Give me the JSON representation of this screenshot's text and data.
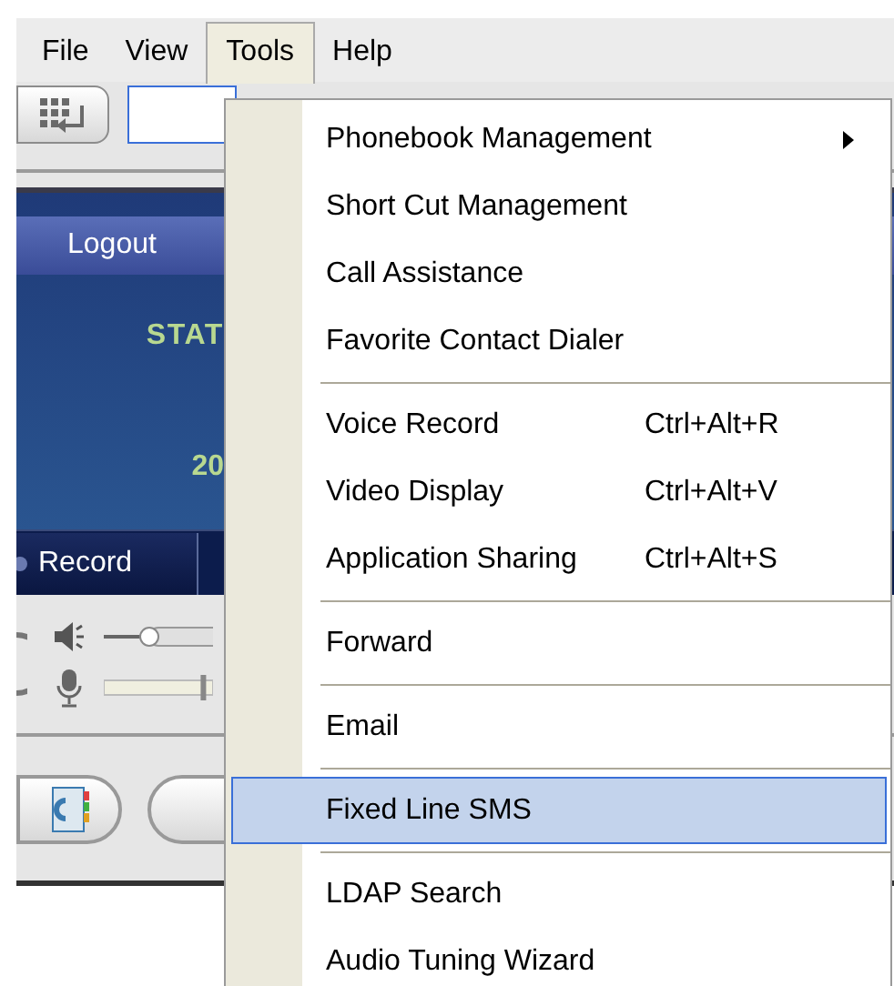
{
  "menu_bar": [
    {
      "label": "File",
      "selected": false
    },
    {
      "label": "View",
      "selected": false
    },
    {
      "label": "Tools",
      "selected": true
    },
    {
      "label": "Help",
      "selected": false
    }
  ],
  "sliders": {
    "speaker": {
      "level": 0.4
    },
    "microphone": {
      "level": 0.95
    }
  },
  "panel": {
    "logout": "Logout",
    "status": "STAT",
    "date": "20",
    "tab": "Record"
  },
  "tools_menu": [
    {
      "kind": "item",
      "label": "Phonebook Management",
      "submenu": true,
      "selected": false
    },
    {
      "kind": "item",
      "label": "Short Cut Management",
      "selected": false
    },
    {
      "kind": "item",
      "label": "Call Assistance",
      "selected": false
    },
    {
      "kind": "item",
      "label": "Favorite Contact Dialer",
      "selected": false
    },
    {
      "kind": "separator"
    },
    {
      "kind": "item",
      "label": "Voice Record",
      "shortcut": "Ctrl+Alt+R",
      "selected": false
    },
    {
      "kind": "item",
      "label": "Video Display",
      "shortcut": "Ctrl+Alt+V",
      "selected": false
    },
    {
      "kind": "item",
      "label": "Application Sharing",
      "shortcut": "Ctrl+Alt+S",
      "selected": false
    },
    {
      "kind": "separator"
    },
    {
      "kind": "item",
      "label": "Forward",
      "selected": false
    },
    {
      "kind": "separator"
    },
    {
      "kind": "item",
      "label": "Email",
      "selected": false
    },
    {
      "kind": "separator"
    },
    {
      "kind": "item",
      "label": "Fixed Line SMS",
      "selected": true
    },
    {
      "kind": "separator"
    },
    {
      "kind": "item",
      "label": "LDAP Search",
      "selected": false
    },
    {
      "kind": "item",
      "label": "Audio Tuning Wizard",
      "selected": false
    }
  ]
}
